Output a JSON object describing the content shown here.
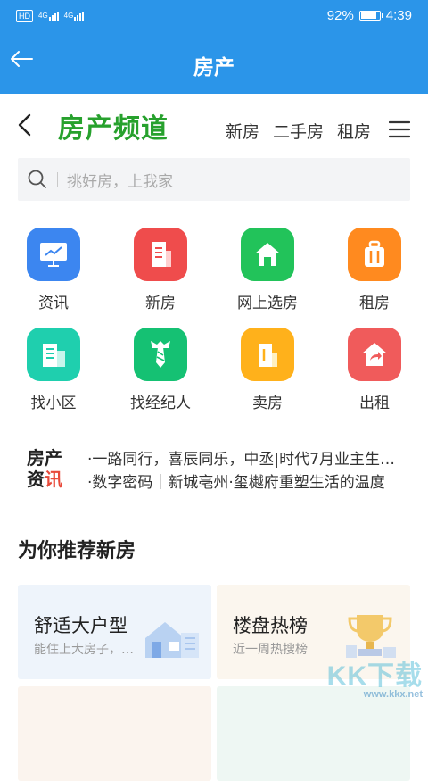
{
  "status_bar": {
    "hd": "HD",
    "sig1": "4G",
    "sig2": "4G",
    "battery_text": "92%",
    "battery_level": 0.92,
    "time": "4:39"
  },
  "app_bar": {
    "title": "房产"
  },
  "header": {
    "channel_title": "房产频道",
    "tabs": [
      "新房",
      "二手房",
      "租房"
    ]
  },
  "search": {
    "placeholder": "挑好房，上我家"
  },
  "grid": [
    {
      "label": "资讯",
      "color": "#3c86f0"
    },
    {
      "label": "新房",
      "color": "#ef4c4c"
    },
    {
      "label": "网上选房",
      "color": "#22c35a"
    },
    {
      "label": "租房",
      "color": "#ff8a1f"
    },
    {
      "label": "找小区",
      "color": "#1fcfae"
    },
    {
      "label": "找经纪人",
      "color": "#15c173"
    },
    {
      "label": "卖房",
      "color": "#ffb11b"
    },
    {
      "label": "出租",
      "color": "#f05b5b"
    }
  ],
  "news": {
    "badge_top": "房产",
    "badge_bottom_a": "资",
    "badge_bottom_b": "讯",
    "items": [
      "·一路同行，喜辰同乐，中丞|时代7月业主生…",
      "·数字密码｜新城亳州·玺樾府重塑生活的温度"
    ]
  },
  "section_title": "为你推荐新房",
  "cards": [
    {
      "title": "舒适大户型",
      "subtitle": "能住上大房子，…",
      "bg": "#eef4fb"
    },
    {
      "title": "楼盘热榜",
      "subtitle": "近一周热搜榜",
      "bg": "#fbf6ee"
    },
    {
      "title": "",
      "subtitle": "",
      "bg": "#fbf4ee"
    },
    {
      "title": "",
      "subtitle": "",
      "bg": "#eef7f3"
    }
  ],
  "watermark": {
    "main": "KK下载",
    "sub": "www.kkx.net"
  },
  "colors": {
    "brand_blue": "#2b95e9",
    "channel_green": "#27a12d"
  }
}
